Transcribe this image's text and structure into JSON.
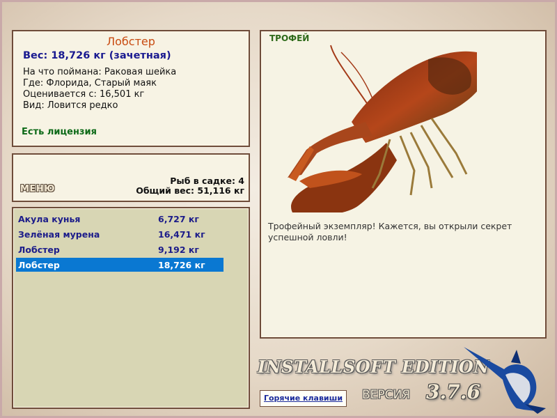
{
  "fish": {
    "name": "Лобстер",
    "weight_line": "Вес: 18,726 кг (зачетная)",
    "caught_on": "На что поймана: Раковая шейка",
    "location": "Где: Флорида, Старый маяк",
    "valued_from": "Оценивается с: 16,501 кг",
    "kind": "Вид: Ловится редко",
    "license": "Есть лицензия"
  },
  "stats": {
    "menu_label": "МЕНЮ",
    "fish_count": "Рыб в садке: 4",
    "total_weight": "Общий вес: 51,116 кг"
  },
  "catch_list": [
    {
      "name": "Акула кунья",
      "weight": "6,727 кг",
      "selected": false
    },
    {
      "name": "Зелёная мурена",
      "weight": "16,471 кг",
      "selected": false
    },
    {
      "name": "Лобстер",
      "weight": "9,192 кг",
      "selected": false
    },
    {
      "name": "Лобстер",
      "weight": "18,726 кг",
      "selected": true
    }
  ],
  "trophy": {
    "badge": "ТРОФЕЙ",
    "message": "Трофейный экземпляр! Кажется, вы открыли секрет успешной ловли!"
  },
  "footer": {
    "edition": "INSTALLSOFT EDITION",
    "version_label": "ВЕРСИЯ",
    "version_number": "3.7.6",
    "hotkeys_label": "Горячие клавиши"
  },
  "colors": {
    "selection": "#0a78d2",
    "panel_border": "#6e4c3a",
    "fish_name": "#c84a10",
    "license": "#0d6a18"
  }
}
